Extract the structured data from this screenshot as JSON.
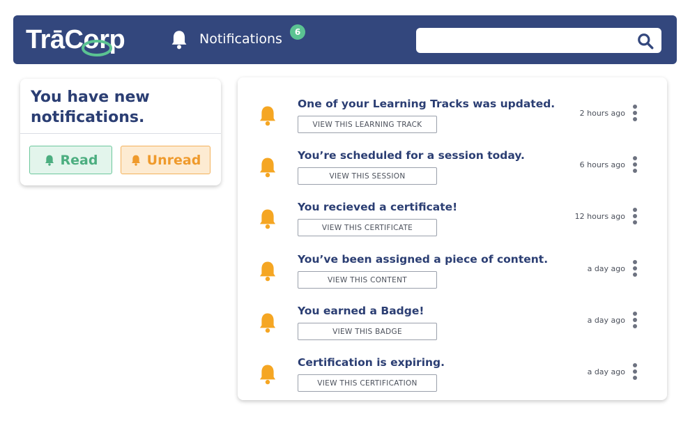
{
  "header": {
    "logo_text": "TrāCorp",
    "nav_label": "Notifications",
    "badge_count": "6",
    "search": {
      "value": "",
      "placeholder": ""
    }
  },
  "left_panel": {
    "title": "You have new notifications.",
    "read_label": "Read",
    "unread_label": "Unread"
  },
  "notifications": [
    {
      "title": "One of your Learning Tracks was updated.",
      "button": "VIEW THIS LEARNING TRACK",
      "time": "2 hours ago"
    },
    {
      "title": "You’re scheduled for a session today.",
      "button": "VIEW THIS SESSION",
      "time": "6 hours ago"
    },
    {
      "title": "You recieved a certificate!",
      "button": "VIEW THIS CERTIFICATE",
      "time": "12 hours ago"
    },
    {
      "title": "You’ve been assigned a piece of content.",
      "button": "VIEW THIS CONTENT",
      "time": "a day ago"
    },
    {
      "title": "You earned a Badge!",
      "button": "VIEW THIS BADGE",
      "time": "a day ago"
    },
    {
      "title": "Certification is expiring.",
      "button": "VIEW THIS CERTIFICATION",
      "time": "a day ago"
    }
  ],
  "icons": {
    "nav": "bell-icon",
    "search": "search-icon",
    "notification": "bell-icon",
    "menu": "more-vertical-icon"
  },
  "colors": {
    "header_bg": "#33477d",
    "badge": "#5bc392",
    "read": "#4cae80",
    "unread": "#ef9a2c",
    "bell": "#f5a623",
    "title_text": "#2b3e73"
  }
}
